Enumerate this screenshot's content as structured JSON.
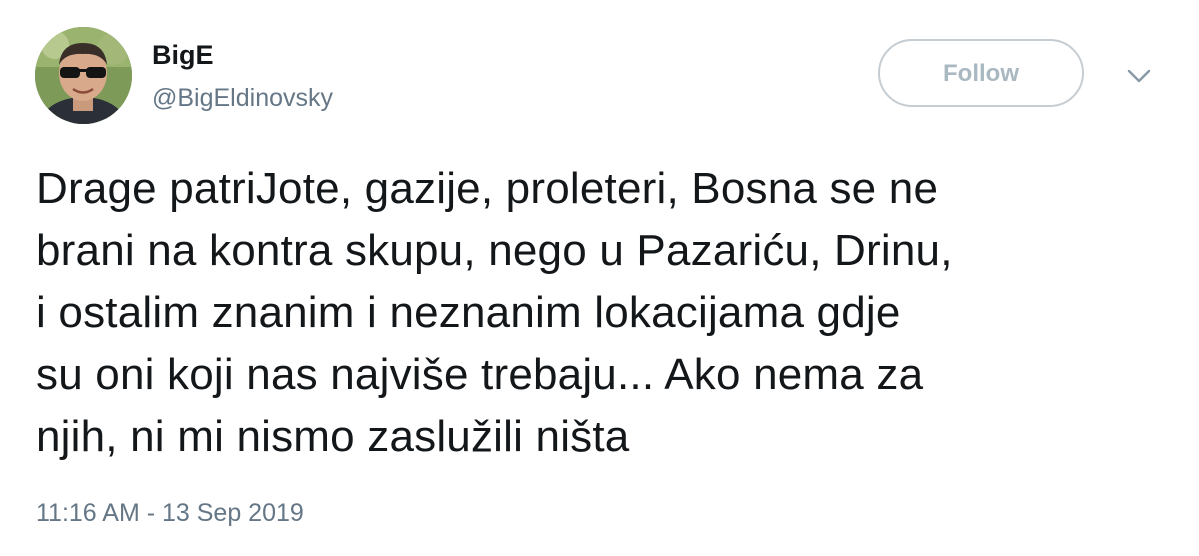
{
  "author": {
    "display_name": "BigE",
    "handle": "@BigEldinovsky",
    "avatar": "profile-photo-avatar"
  },
  "actions": {
    "follow_label": "Follow",
    "menu_icon": "chevron-down-icon"
  },
  "tweet": {
    "lines": [
      "Drage patriJote, gazije, proleteri, Bosna se ne",
      "brani na kontra skupu, nego u Pazariću, Drinu,",
      "i ostalim znanim i neznanim lokacijama gdje",
      "su oni koji nas najviše trebaju... Ako nema za",
      "njih, ni mi nismo zaslužili ništa"
    ],
    "timestamp": "11:16 AM - 13 Sep 2019"
  },
  "colors": {
    "text_primary": "#14171a",
    "text_secondary": "#657786",
    "follow_border": "#c5cdd3",
    "follow_text": "#aab8c2"
  }
}
